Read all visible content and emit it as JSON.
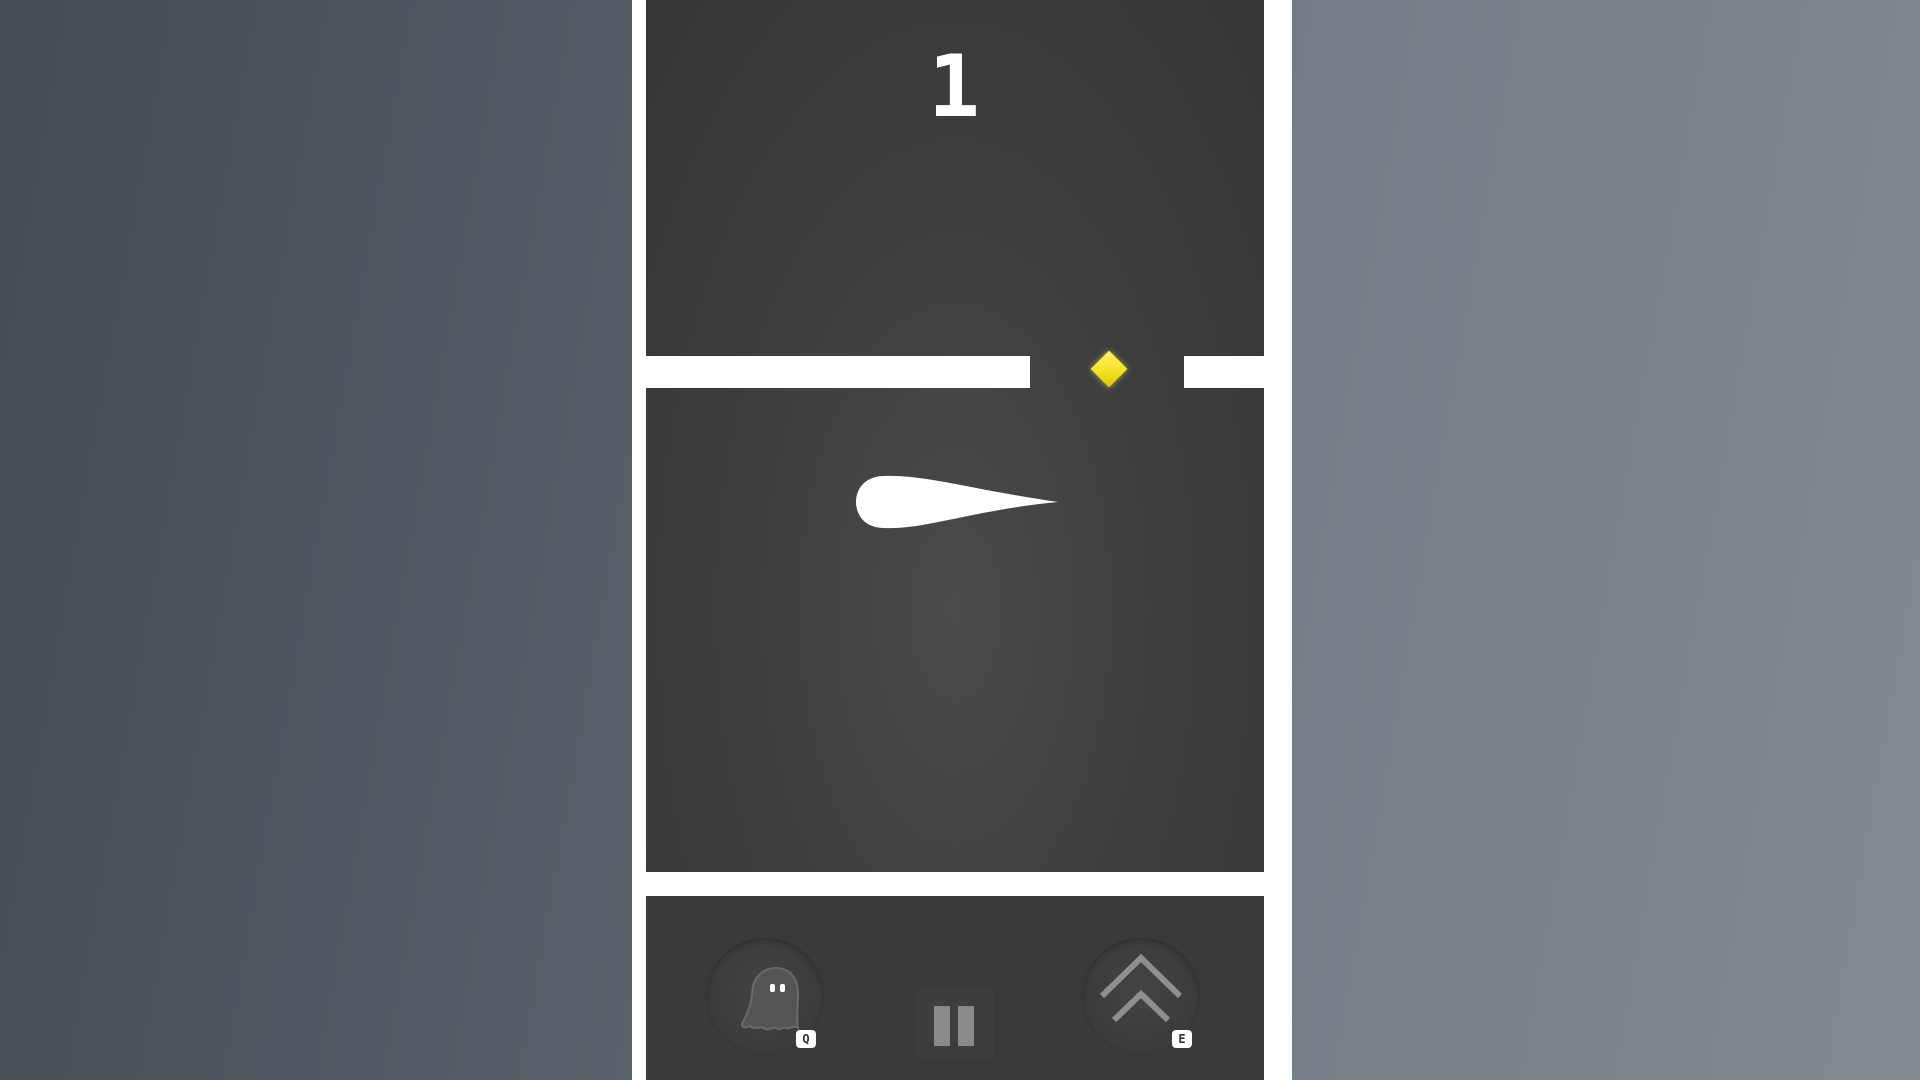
{
  "score": "1",
  "controls": {
    "ghost_key": "Q",
    "boost_key": "E",
    "ghost_icon": "ghost-icon",
    "boost_icon": "double-chevron-up-icon",
    "pause_icon": "pause-icon"
  },
  "colors": {
    "play_area": "#3f3f3f",
    "wall": "#ffffff",
    "gem": "#f2e020",
    "control_bar": "#3a3a3a"
  }
}
